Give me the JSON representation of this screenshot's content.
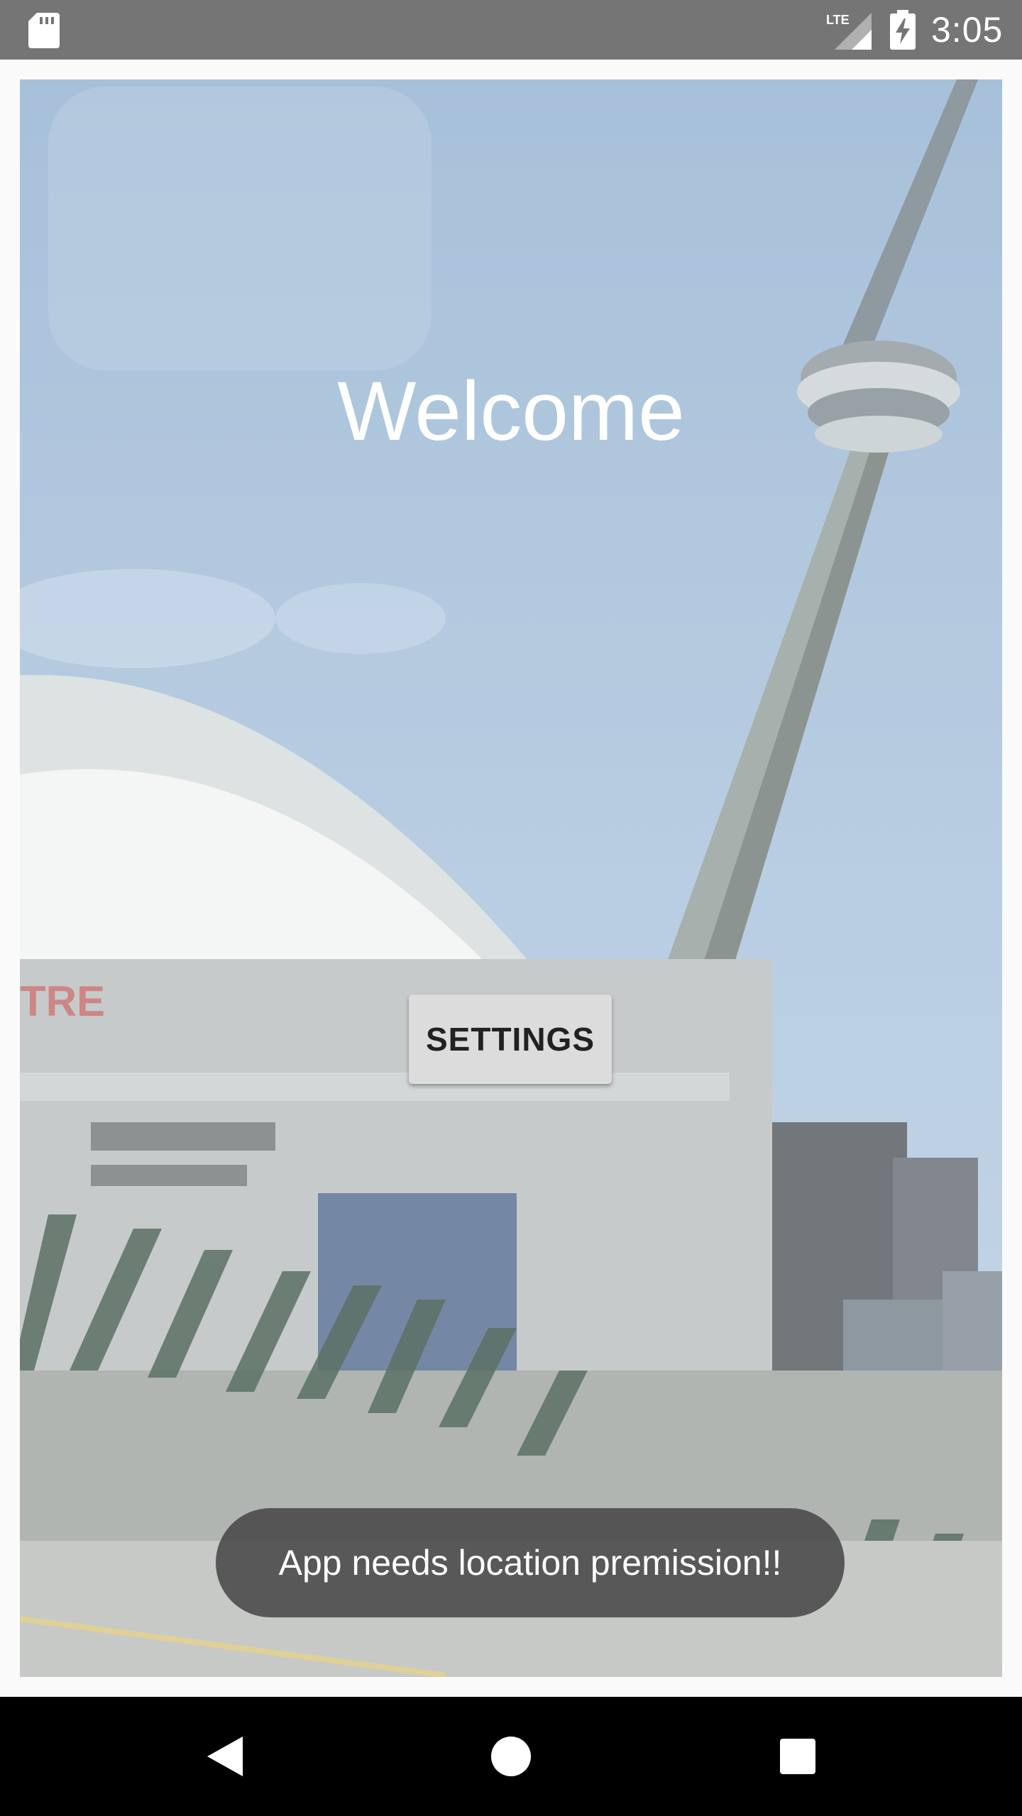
{
  "status_bar": {
    "network_label": "LTE",
    "time": "3:05",
    "icons": [
      "sd-card-icon",
      "lte-signal-icon",
      "battery-charging-icon"
    ]
  },
  "main": {
    "title": "Welcome",
    "settings_button_label": "SETTINGS",
    "background_image": "city skyline with tower and domed stadium"
  },
  "toast": {
    "message": "App needs location premission!!"
  },
  "nav_bar": {
    "icons": [
      "back-icon",
      "home-icon",
      "recents-icon"
    ]
  },
  "colors": {
    "status_bar": "#757575",
    "nav_bar": "#000000",
    "button_bg": "#dcdcdc",
    "toast_bg": "#484848"
  }
}
